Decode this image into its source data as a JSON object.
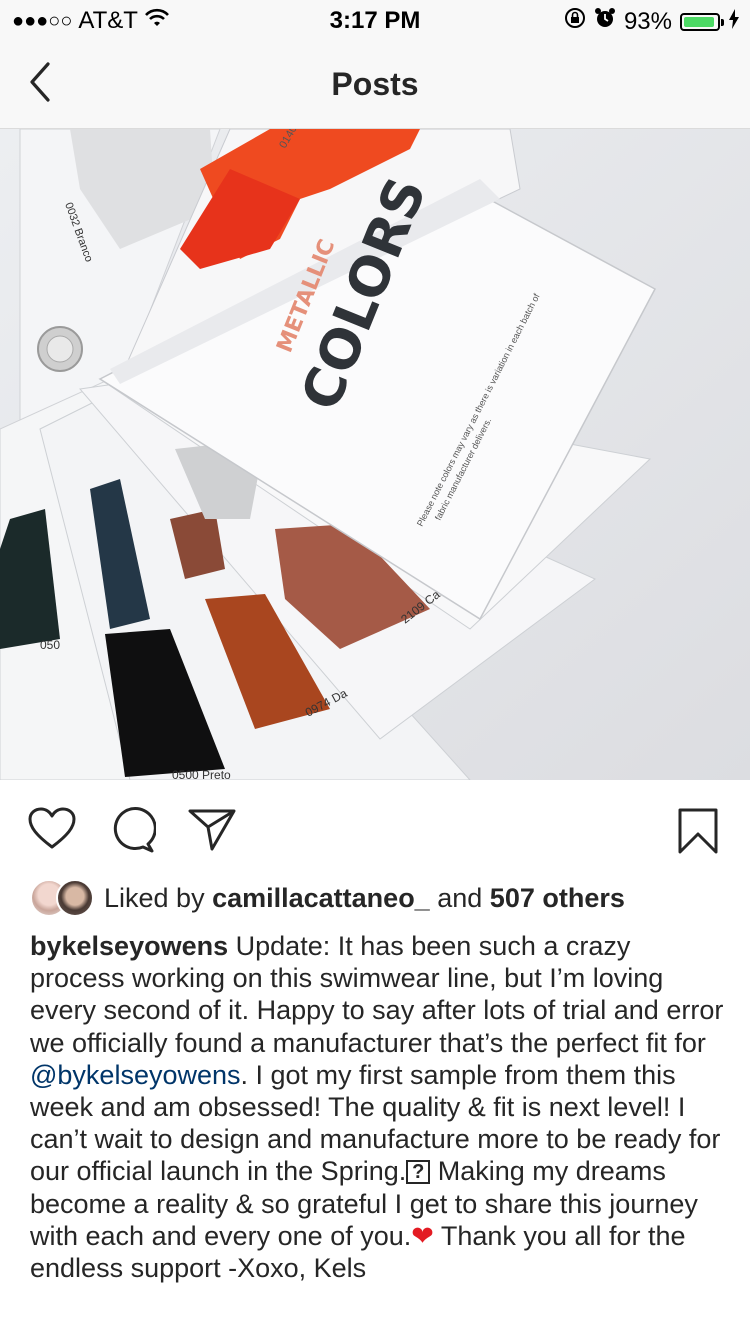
{
  "status_bar": {
    "signal": "●●●○○",
    "carrier": "AT&T",
    "time": "3:17 PM",
    "battery": "93%",
    "battery_level": 0.93
  },
  "nav": {
    "title": "Posts"
  },
  "photo": {
    "swatch_title": "COLORS",
    "swatch_subtitle": "METALLIC",
    "note_line1": "Please note colors may vary as there is variation in each batch of",
    "note_line2": "fabric manufacturer delivers.",
    "label_2109": "2109 Cal",
    "label_0974": "0974 Da",
    "label_0500": "0500 Preto",
    "label_050": "050",
    "label_0032": "0032 Branco",
    "label_top": "0140"
  },
  "actions": {
    "like_icon": "heart-icon",
    "comment_icon": "comment-icon",
    "share_icon": "paper-plane-icon",
    "save_icon": "bookmark-icon"
  },
  "likes": {
    "prefix": "Liked by",
    "user": "camillacattaneo_",
    "and": "and",
    "others": "507 others"
  },
  "caption": {
    "username": "bykelseyowens",
    "text1": "Update: It has been such a crazy process working on this swimwear line, but I’m loving every second of it. Happy to say after lots of trial and error we officially found a manufacturer that’s the perfect fit for",
    "mention": "@bykelseyowens",
    "text2": ". I got my first sample from them this week and am obsessed! The quality & fit is next level! I can’t wait to design and manufacture more to be ready for our official launch in the Spring.",
    "unknown_glyph": "?",
    "text3": "Making my dreams become a reality & so grateful I get to share this journey with each and every one of you.",
    "heart_glyph": "❤",
    "text4": "Thank you all for the endless support -Xoxo, Kels"
  },
  "colors": {
    "mention": "#003569",
    "heart": "#e31b23",
    "battery": "#4cd964"
  }
}
